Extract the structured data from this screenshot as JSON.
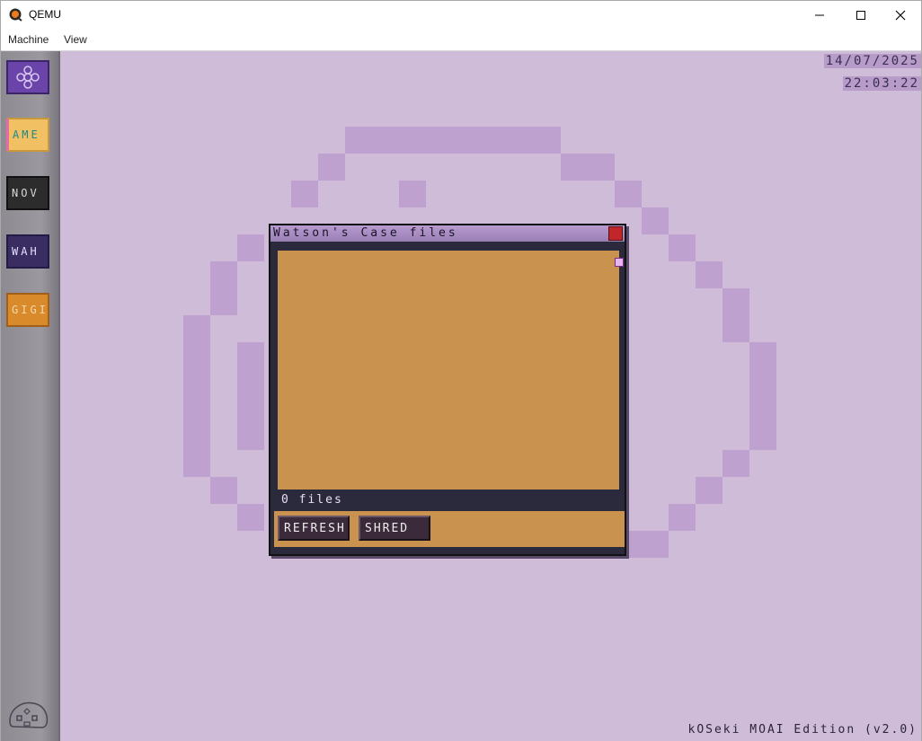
{
  "window": {
    "title": "QEMU",
    "controls": {
      "minimize": "minimize-icon",
      "maximize": "maximize-icon",
      "close": "close-icon"
    }
  },
  "menubar": {
    "items": [
      "Machine",
      "View"
    ]
  },
  "desktop": {
    "date": "14/07/2025",
    "time": "22:03:22",
    "footer": "kOSeki MOAI Edition (v2.0)",
    "sidebar": {
      "items": [
        {
          "label": "",
          "icon": "settings-flower-icon"
        },
        {
          "label": "AME"
        },
        {
          "label": "NOV"
        },
        {
          "label": "WAH"
        },
        {
          "label": "GIGI"
        }
      ],
      "bottom_icon": "moai-logo-icon"
    },
    "colors": {
      "background": "#cfbcd9",
      "panel_accent": "#c9934f",
      "dialog_frame": "#2b2a3c",
      "close_button": "#c0262a"
    }
  },
  "dialog": {
    "title": "Watson's Case files",
    "status": "0 files",
    "buttons": {
      "refresh": "REFRESH",
      "shred": "SHRED"
    }
  }
}
